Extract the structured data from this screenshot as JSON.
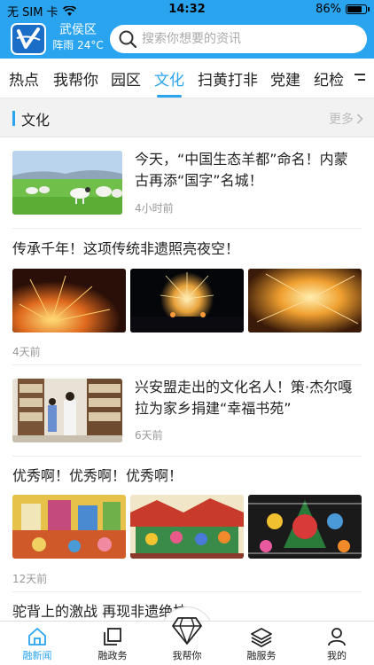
{
  "status": {
    "carrier": "无 SIM 卡",
    "time": "14:32",
    "battery": "86%",
    "battery_level": 0.86
  },
  "header": {
    "district": "武侯区",
    "weather": "阵雨 24°C",
    "search_placeholder": "搜索你想要的资讯"
  },
  "tabs": [
    {
      "label": "热点"
    },
    {
      "label": "我帮你"
    },
    {
      "label": "园区"
    },
    {
      "label": "文化",
      "active": true
    },
    {
      "label": "扫黄打非"
    },
    {
      "label": "党建"
    },
    {
      "label": "纪检"
    }
  ],
  "section": {
    "title": "文化",
    "more": "更多"
  },
  "articles": [
    {
      "title": "今天，“中国生态羊都”命名！内蒙古再添“国字”名城！",
      "time": "4小时前"
    },
    {
      "title": "传承千年！这项传统非遗照亮夜空！",
      "time": "4天前"
    },
    {
      "title": "兴安盟走出的文化名人！策·杰尔嘎拉为家乡捐建“幸福书苑”",
      "time": "6天前"
    },
    {
      "title": "优秀啊！优秀啊！优秀啊！",
      "time": "12天前"
    },
    {
      "title": "驼背上的激战 再现非遗绝技"
    }
  ],
  "bottom_nav": [
    {
      "label": "融新闻",
      "icon": "home-icon",
      "active": true
    },
    {
      "label": "融政务",
      "icon": "squares-icon"
    },
    {
      "label": "我帮你",
      "icon": "diamond-icon"
    },
    {
      "label": "融服务",
      "icon": "layers-icon"
    },
    {
      "label": "我的",
      "icon": "user-icon"
    }
  ],
  "colors": {
    "accent": "#2aa4ef"
  }
}
